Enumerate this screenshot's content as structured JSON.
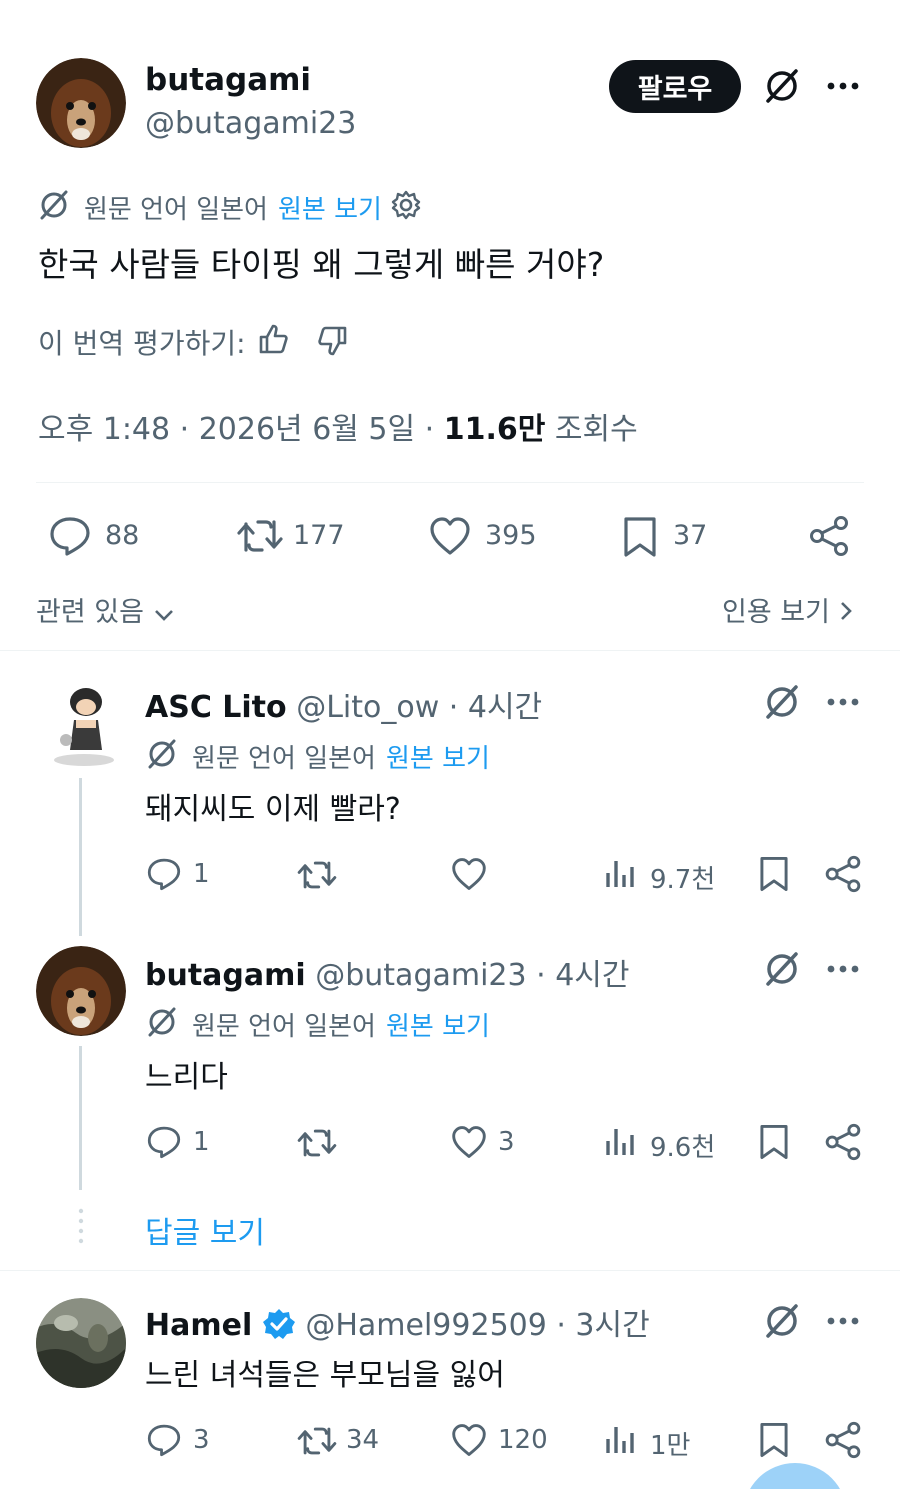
{
  "post": {
    "author_name": "butagami",
    "author_handle": "@butagami23",
    "follow_label": "팔로우",
    "translation_note": "원문 언어 일본어",
    "view_original": "원본 보기",
    "text": "한국 사람들 타이핑 왜 그렇게 빠른 거야?",
    "rate_translation": "이 번역 평가하기:",
    "time": "오후 1:48 · 2026년 6월 5일 · ",
    "views_count": "11.6만",
    "views_label": " 조회수",
    "stats": {
      "replies": "88",
      "reposts": "177",
      "likes": "395",
      "bookmarks": "37"
    },
    "related": "관련 있음",
    "quotes": "인용 보기"
  },
  "replies": [
    {
      "name": "ASC Lito",
      "handle": "@Lito_ow · 4시간",
      "translation_note": "원문 언어 일본어",
      "view_original": "원본 보기",
      "text": "돼지씨도 이제 빨라?",
      "replies": "1",
      "reposts": "",
      "likes": "",
      "views": "9.7천"
    },
    {
      "name": "butagami",
      "handle": "@butagami23 · 4시간",
      "translation_note": "원문 언어 일본어",
      "view_original": "원본 보기",
      "text": "느리다",
      "replies": "1",
      "reposts": "",
      "likes": "3",
      "views": "9.6천"
    },
    {
      "name": "Hamel",
      "handle": "@Hamel992509 · 3시간",
      "text": "느린 녀석들은 부모님을 잃어",
      "replies": "3",
      "reposts": "34",
      "likes": "120",
      "views": "1만"
    }
  ],
  "show_replies": "답글 보기",
  "colors": {
    "link": "#1d9bf0",
    "muted": "#536471",
    "text": "#0f1419",
    "verified": "#1d9bf0"
  }
}
